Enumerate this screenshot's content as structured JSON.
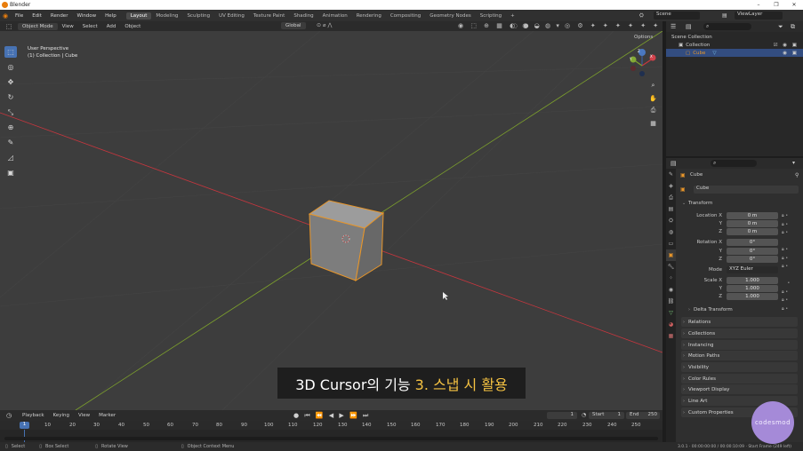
{
  "window": {
    "title": "Blender",
    "minimize": "–",
    "maximize": "❐",
    "close": "✕"
  },
  "menu": [
    "File",
    "Edit",
    "Render",
    "Window",
    "Help"
  ],
  "workspaces": [
    "Layout",
    "Modeling",
    "Sculpting",
    "UV Editing",
    "Texture Paint",
    "Shading",
    "Animation",
    "Rendering",
    "Compositing",
    "Geometry Nodes",
    "Scripting"
  ],
  "workspace_add": "+",
  "scene": {
    "scene_name": "Scene",
    "view_layer": "ViewLayer"
  },
  "viewport": {
    "mode": "Object Mode",
    "header_menus": [
      "View",
      "Select",
      "Add",
      "Object"
    ],
    "transform_orientation": "Global",
    "options_label": "Options",
    "info_line1": "User Perspective",
    "info_line2": "(1) Collection | Cube",
    "gizmo": {
      "x": "X",
      "y": "Y",
      "z": "Z"
    },
    "nav_icons": [
      "magnify-icon",
      "hand-icon",
      "camera-icon",
      "grid-icon"
    ]
  },
  "caption": {
    "main": "3D Cursor의 기능",
    "highlight": "3. 스냅 시 활용"
  },
  "timeline": {
    "menus": [
      "Playback",
      "Keying",
      "View",
      "Marker"
    ],
    "current_frame": "1",
    "start_label": "Start",
    "start": "1",
    "end_label": "End",
    "end": "250",
    "ticks": [
      "1",
      "10",
      "20",
      "30",
      "40",
      "50",
      "60",
      "70",
      "80",
      "90",
      "100",
      "110",
      "120",
      "130",
      "140",
      "150",
      "160",
      "170",
      "180",
      "190",
      "200",
      "210",
      "220",
      "230",
      "240",
      "250"
    ]
  },
  "statusbar": {
    "select": "Select",
    "box_select": "Box Select",
    "rotate_view": "Rotate View",
    "context_menu": "Object Context Menu",
    "version": "3.0.1 · 00:00:00:00 / 00:00:10:09 · Start Frame (249 left)"
  },
  "outliner": {
    "rows": [
      {
        "label": "Scene Collection",
        "indent": 0
      },
      {
        "label": "Collection",
        "indent": 1
      },
      {
        "label": "Cube",
        "indent": 2,
        "selected": true
      }
    ]
  },
  "properties": {
    "object_name": "Cube",
    "object_field": "Cube",
    "transform_label": "Transform",
    "location": {
      "label_x": "Location X",
      "x": "0 m",
      "y": "0 m",
      "z": "0 m"
    },
    "rotation": {
      "label_x": "Rotation X",
      "x": "0°",
      "y": "0°",
      "z": "0°"
    },
    "mode_label": "Mode",
    "mode_value": "XYZ Euler",
    "scale": {
      "label_x": "Scale X",
      "x": "1.000",
      "y": "1.000",
      "z": "1.000"
    },
    "axis_y": "Y",
    "axis_z": "Z",
    "delta_transform": "Delta Transform",
    "panels": [
      "Relations",
      "Collections",
      "Instancing",
      "Motion Paths",
      "Visibility",
      "Color Rules",
      "Viewport Display",
      "Line Art",
      "Custom Properties"
    ]
  },
  "watermark": "codesmod",
  "colors": {
    "accent": "#4772b3",
    "selection": "#e8962a",
    "x_axis": "#c8363e",
    "y_axis": "#7ea22c",
    "highlight_text": "#f5c242"
  }
}
